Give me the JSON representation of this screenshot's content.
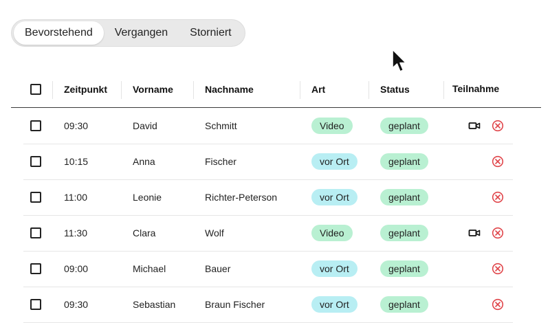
{
  "tabs": [
    {
      "label": "Bevorstehend",
      "active": true
    },
    {
      "label": "Vergangen",
      "active": false
    },
    {
      "label": "Storniert",
      "active": false
    }
  ],
  "table": {
    "columns": [
      "Zeitpunkt",
      "Vorname",
      "Nachname",
      "Art",
      "Status",
      "Teilnahme"
    ],
    "rows": [
      {
        "time": "09:30",
        "first": "David",
        "last": "Schmitt",
        "art": "Video",
        "status": "geplant",
        "video": true
      },
      {
        "time": "10:15",
        "first": "Anna",
        "last": "Fischer",
        "art": "vor Ort",
        "status": "geplant",
        "video": false
      },
      {
        "time": "11:00",
        "first": "Leonie",
        "last": "Richter-Peterson",
        "art": "vor Ort",
        "status": "geplant",
        "video": false
      },
      {
        "time": "11:30",
        "first": "Clara",
        "last": "Wolf",
        "art": "Video",
        "status": "geplant",
        "video": true
      },
      {
        "time": "09:00",
        "first": "Michael",
        "last": "Bauer",
        "art": "vor Ort",
        "status": "geplant",
        "video": false
      },
      {
        "time": "09:30",
        "first": "Sebastian",
        "last": "Braun Fischer",
        "art": "vor Ort",
        "status": "geplant",
        "video": false
      }
    ]
  },
  "colors": {
    "pill_video": "#b9f0d2",
    "pill_vor_ort": "#b8eef3",
    "pill_status": "#b9f0d2",
    "cancel_icon": "#e0454a"
  },
  "icons": {
    "video": "video-camera-icon",
    "cancel": "cancel-circle-icon",
    "cursor": "mouse-cursor-icon"
  }
}
